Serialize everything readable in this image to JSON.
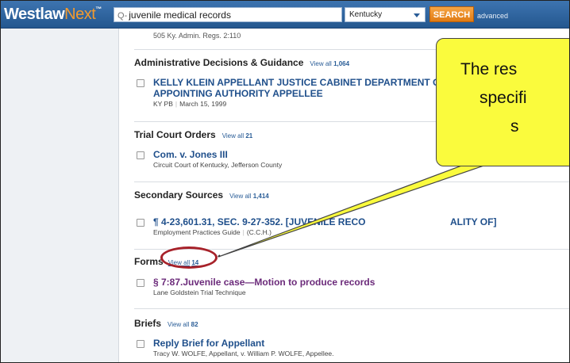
{
  "header": {
    "logo_main": "Westlaw",
    "logo_next": "Next",
    "logo_mark": "™",
    "search_icon_glyph": "Q",
    "search_value": "juvenile medical records",
    "jurisdiction": "Kentucky",
    "search_button": "SEARCH",
    "advanced_link": "advanced"
  },
  "results": {
    "top_cite": "505 Ky. Admin. Regs. 2:110",
    "sections": [
      {
        "heading": "Administrative Decisions & Guidance",
        "view_all_prefix": "View all",
        "view_all_count": "1,064",
        "item_title_line1": "KELLY KLEIN APPELLANT JUSTICE CABINET DEPARTMENT O",
        "item_title_line2": "APPOINTING AUTHORITY APPELLEE",
        "meta_a": "KY PB",
        "meta_b": "March 15, 1999"
      },
      {
        "heading": "Trial Court Orders",
        "view_all_prefix": "View all",
        "view_all_count": "21",
        "item_title": "Com. v. Jones III",
        "meta_a": "Circuit Court of Kentucky, Jefferson County"
      },
      {
        "heading": "Secondary Sources",
        "view_all_prefix": "View all",
        "view_all_count": "1,414",
        "item_title_left": "¶ 4-23,601.31, SEC. 9-27-352. [JUVENILE RECO",
        "item_title_right": "ALITY OF]",
        "meta_a": "Employment Practices Guide",
        "meta_b": "(C.C.H.)"
      },
      {
        "heading": "Forms",
        "view_all_prefix": "View all",
        "view_all_count": "14",
        "item_title": "§ 7:87.Juvenile case—Motion to produce records",
        "meta_a": "Lane Goldstein Trial Technique"
      },
      {
        "heading": "Briefs",
        "view_all_prefix": "View all",
        "view_all_count": "82",
        "item_title": "Reply Brief for Appellant",
        "meta_a": "Tracy W. WOLFE, Appellant, v. William P. WOLFE, Appellee."
      }
    ]
  },
  "callout": {
    "line1": "The res",
    "line2": "specifi",
    "line3": "s",
    "fill_color": "#fafb3d",
    "oval_color": "#a7222a"
  }
}
